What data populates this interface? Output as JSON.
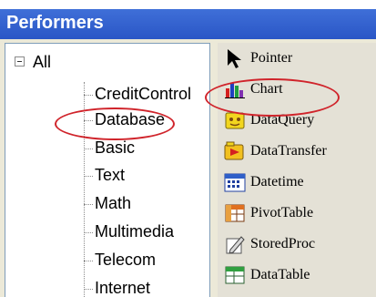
{
  "window": {
    "title": "Performers"
  },
  "tree": {
    "root": {
      "label": "All",
      "expanded": true
    },
    "items": [
      {
        "label": "CreditControl"
      },
      {
        "label": "Database",
        "highlighted": true
      },
      {
        "label": "Basic"
      },
      {
        "label": "Text"
      },
      {
        "label": "Math"
      },
      {
        "label": "Multimedia"
      },
      {
        "label": "Telecom"
      },
      {
        "label": "Internet"
      }
    ]
  },
  "toolbox": {
    "items": [
      {
        "label": "Pointer",
        "icon": "pointer-icon"
      },
      {
        "label": "Chart",
        "icon": "chart-icon",
        "highlighted": true
      },
      {
        "label": "DataQuery",
        "icon": "dataquery-icon"
      },
      {
        "label": "DataTransfer",
        "icon": "datatransfer-icon"
      },
      {
        "label": "Datetime",
        "icon": "datetime-icon"
      },
      {
        "label": "PivotTable",
        "icon": "pivottable-icon"
      },
      {
        "label": "StoredProc",
        "icon": "storedproc-icon"
      },
      {
        "label": "DataTable",
        "icon": "datatable-icon"
      }
    ]
  },
  "colors": {
    "title_bar": "#2a56c6",
    "annotation": "#d0242b",
    "frame": "#ece9d8"
  }
}
